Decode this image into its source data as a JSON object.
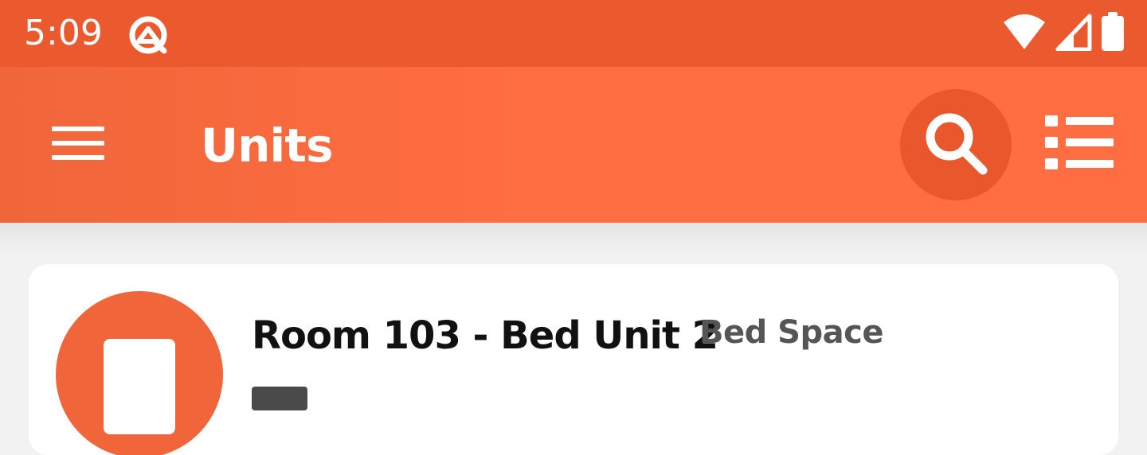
{
  "status_bar": {
    "time": "5:09",
    "icons": [
      "app-notification-icon",
      "wifi-icon",
      "cell-signal-icon",
      "battery-icon"
    ]
  },
  "app_bar": {
    "title": "Units",
    "menu_icon": "hamburger-menu-icon",
    "search_icon": "search-icon",
    "list_icon": "list-view-icon"
  },
  "units": [
    {
      "title": "Room 103 - Bed Unit 2",
      "type": "Bed Space",
      "avatar_icon": "door-icon"
    }
  ],
  "colors": {
    "status_bar": "#ea5a2e",
    "app_bar": "#ff6d42",
    "accent": "#f0663a",
    "background": "#f2f2f2"
  }
}
